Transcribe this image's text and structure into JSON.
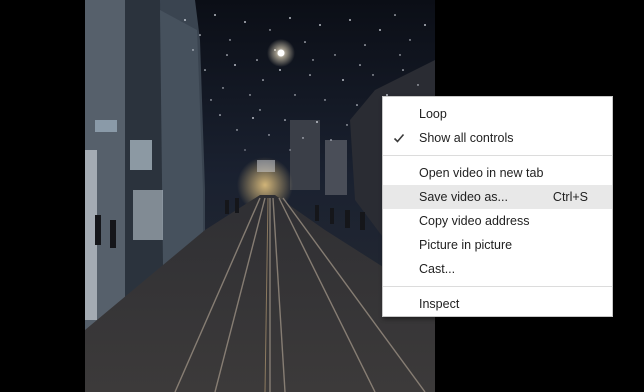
{
  "video": {
    "description_icon": "night-street-video-frame"
  },
  "context_menu": {
    "items": [
      {
        "label": "Loop",
        "checked": false,
        "shortcut": ""
      },
      {
        "label": "Show all controls",
        "checked": true,
        "shortcut": ""
      },
      {
        "label": "Open video in new tab",
        "checked": false,
        "shortcut": ""
      },
      {
        "label": "Save video as...",
        "checked": false,
        "shortcut": "Ctrl+S",
        "highlighted": true
      },
      {
        "label": "Copy video address",
        "checked": false,
        "shortcut": ""
      },
      {
        "label": "Picture in picture",
        "checked": false,
        "shortcut": ""
      },
      {
        "label": "Cast...",
        "checked": false,
        "shortcut": ""
      },
      {
        "label": "Inspect",
        "checked": false,
        "shortcut": ""
      }
    ]
  },
  "colors": {
    "background": "#000000",
    "menu_background": "#ffffff",
    "menu_highlight": "#e8e8e8",
    "menu_text": "#1f1f1f"
  }
}
